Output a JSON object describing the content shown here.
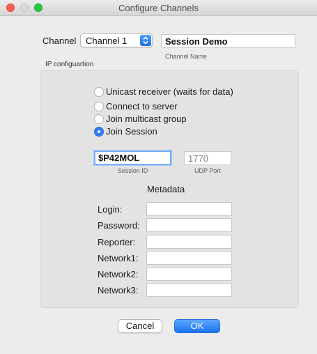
{
  "window": {
    "title": "Configure Channels"
  },
  "channel": {
    "label": "Channel",
    "selected": "Channel 1",
    "name_value": "Session Demo",
    "name_caption": "Channel Name"
  },
  "ip": {
    "group_label": "IP configuartion",
    "options": [
      {
        "label": "Unicast receiver (waits for data)",
        "selected": false
      },
      {
        "label": "Connect to server",
        "selected": false
      },
      {
        "label": "Join multicast group",
        "selected": false
      },
      {
        "label": "Join Session",
        "selected": true
      }
    ],
    "session_id": {
      "value": "$P42MOL",
      "caption": "Session ID"
    },
    "udp_port": {
      "value": "1770",
      "caption": "UDP Port"
    }
  },
  "metadata": {
    "title": "Metadata",
    "fields": [
      {
        "label": "Login:",
        "value": ""
      },
      {
        "label": "Password:",
        "value": ""
      },
      {
        "label": "Reporter:",
        "value": ""
      },
      {
        "label": "Network1:",
        "value": ""
      },
      {
        "label": "Network2:",
        "value": ""
      },
      {
        "label": "Network3:",
        "value": ""
      }
    ]
  },
  "buttons": {
    "cancel": "Cancel",
    "ok": "OK"
  },
  "colors": {
    "accent": "#2f7cf6",
    "close": "#fe5f57",
    "maximize": "#28c940"
  },
  "icons": {
    "select_arrows": "chevron-up-down-icon"
  }
}
